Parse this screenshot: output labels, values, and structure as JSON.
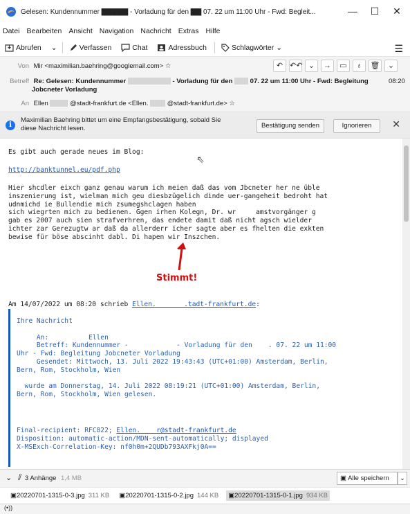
{
  "titlebar": {
    "title": "Gelesen: Kundennummer ▇▇▇▇▇ - Vorladung für den ▇▇ 07. 22 um 11:00 Uhr - Fwd: Begleit...",
    "minimize": "—",
    "maximize": "☐",
    "close": "✕"
  },
  "menu": [
    "Datei",
    "Bearbeiten",
    "Ansicht",
    "Navigation",
    "Nachricht",
    "Extras",
    "Hilfe"
  ],
  "toolbar": {
    "get": "Abrufen",
    "compose": "Verfassen",
    "chat": "Chat",
    "addressbook": "Adressbuch",
    "tags": "Schlagwörter"
  },
  "header": {
    "from_label": "Von",
    "from_value": "Mir <maximilian.baehring@googlemail.com>",
    "subject_label": "Betreff",
    "subject_a": "Re: Gelesen: Kundennummer",
    "subject_b": "- Vorladung für den",
    "subject_c": "07. 22 um 11:00 Uhr - Fwd: Begleitung",
    "subject_d": "Jobcneter Vorladung",
    "time": "08:20",
    "to_label": "An",
    "to_a": "Ellen",
    "to_b": "@stadt-frankfurt.de",
    "to_c": "<Ellen.",
    "to_d": "@stadt-frankfurt.de>"
  },
  "notify": {
    "text": "Maximilian Baehring bittet um eine Empfangsbestätigung, sobald Sie diese Nachricht lesen.",
    "confirm": "Bestätigung senden",
    "ignore": "Ignorieren",
    "close": "✕"
  },
  "body": {
    "line1": "Es gibt auch gerade neues im Blog:",
    "link": "http://banktunnel.eu/pdf.php",
    "para": "Hier shcdler eixch ganz genau warum ich meien daß das vom Jbcneter her ne üble\ninszenierung ist, wielman mich geu diesbzügelich dinde uer-gangeheit bedroht hat\nudnmichd ie Bullendie mich zsumegshclagen haben\nsich wiegrten mich zu bedienen. Ggen irhen Kolegn, Dr. wr     amstvorgänger g\ngab es 2007 auch sien strafverhren, das endete damit daß nicht agsch wielder\nichter zar Gerezugtw ar daß da allerderr icher sagte aber es fhelten die exkten\nbewise für böse abscinht dabl. Di hapen wir Inszchen.",
    "annotation": "Stimmt!",
    "quote_header_a": "Am 14/07/2022 um 08:20 schrieb ",
    "quote_header_link": "Ellen.       .tadt-frankfurt.de",
    "quote_header_b": ":",
    "cite": "Ihre Nachricht\n\n     An:          Ellen\n     Betreff: Kundennummer -            - Vorladung für den    . 07. 22 um 11:00\nUhr - Fwd: Begleitung Jobcneter Vorladung\n     Gesendet: Mittwoch, 13. Juli 2022 19:43:43 (UTC+01:00) Amsterdam, Berlin,\nBern, Rom, Stockholm, Wien\n\n  wurde am Donnerstag, 14. Juli 2022 08:19:21 (UTC+01:00) Amsterdam, Berlin,\nBern, Rom, Stockholm, Wien gelesen.\n\n",
    "final_a": "Final-recipient: RFC822; ",
    "final_link": "Ellen.    r@stadt-frankfurt.de",
    "disposition": "Disposition: automatic-action/MDN-sent-automatically; displayed",
    "correlation": "X-MSExch-Correlation-Key: nf0h0m+2QUDb793AXFkj0A=="
  },
  "attachments": {
    "summary": "3 Anhänge",
    "total_size": "1,4 MB",
    "save_all": "Alle speichern",
    "items": [
      {
        "name": "20220701-1315-0-3.jpg",
        "size": "311 KB"
      },
      {
        "name": "20220701-1315-0-2.jpg",
        "size": "144 KB"
      },
      {
        "name": "20220701-1315-0-1.jpg",
        "size": "934 KB"
      }
    ]
  },
  "status": {
    "text": "(•))"
  }
}
